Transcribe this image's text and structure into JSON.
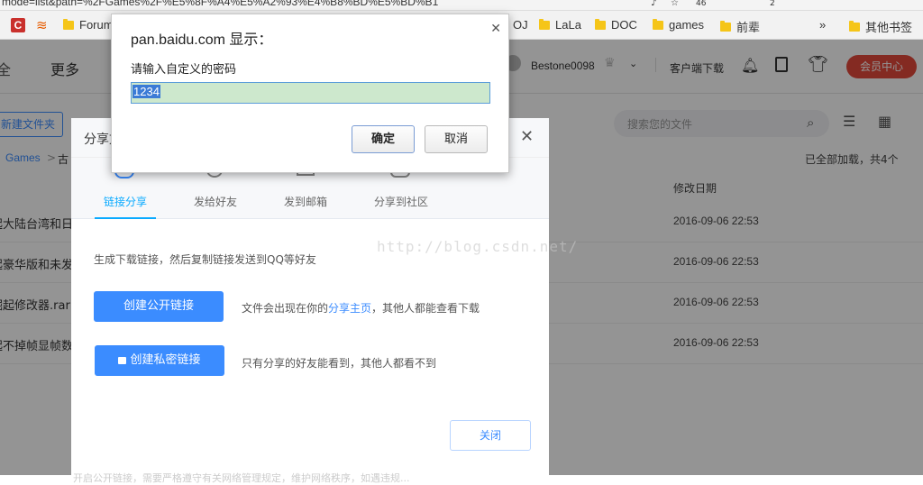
{
  "browser": {
    "url": "mode=list&path=%2FGames%2F%E5%8F%A4%E5%A2%93%E4%B8%BD%E5%BD%B1",
    "badge_46": "46",
    "badge_2": "2",
    "bookmarks": [
      "Forum",
      "OJ",
      "LaLa",
      "DOC",
      "games",
      "前辈"
    ],
    "more_label": "»",
    "other_bookmarks": "其他书签"
  },
  "app": {
    "more_label": "更多",
    "username": "Bestone0098",
    "client_download": "客户端下载",
    "vip_button": "会员中心",
    "new_folder": "新建文件夹",
    "search_placeholder": "搜索您的文件",
    "breadcrumb_root": "Games",
    "breadcrumb_sep": ">",
    "breadcrumb_current": "古",
    "loaded_status": "已全部加载，共4个",
    "modified_header": "修改日期",
    "files": [
      {
        "name": "起大陆台湾和日",
        "date": "2016-09-06 22:53"
      },
      {
        "name": "起豪华版和未发",
        "date": "2016-09-06 22:53"
      },
      {
        "name": "掘起修改器.rar",
        "date": "2016-09-06 22:53"
      },
      {
        "name": "起不掉帧显帧数",
        "date": "2016-09-06 22:53"
      }
    ]
  },
  "share_dialog": {
    "title": "分享文",
    "tabs": [
      "链接分享",
      "发给好友",
      "发到邮箱",
      "分享到社区"
    ],
    "hint": "生成下载链接，然后复制链接发送到QQ等好友",
    "public_button": "创建公开链接",
    "public_desc_prefix": "文件会出现在你的",
    "public_desc_link": "分享主页",
    "public_desc_suffix": "，其他人都能查看下载",
    "private_button": "创建私密链接",
    "private_desc": "只有分享的好友能看到，其他人都看不到",
    "close_button": "关闭",
    "footer_text": "开启公开链接，需要严格遵守有关网络管理规定，维护网络秩序，如遇违规..."
  },
  "alert": {
    "title": "pan.baidu.com 显示：",
    "message": "请输入自定义的密码",
    "input_value": "1234",
    "ok_button": "确定",
    "cancel_button": "取消"
  },
  "watermark": "http://blog.csdn.net/",
  "colors": {
    "accent_blue": "#3b8cff",
    "tab_active": "#09aaff",
    "vip_red": "#e4493c",
    "input_highlight": "#cde8cd"
  }
}
